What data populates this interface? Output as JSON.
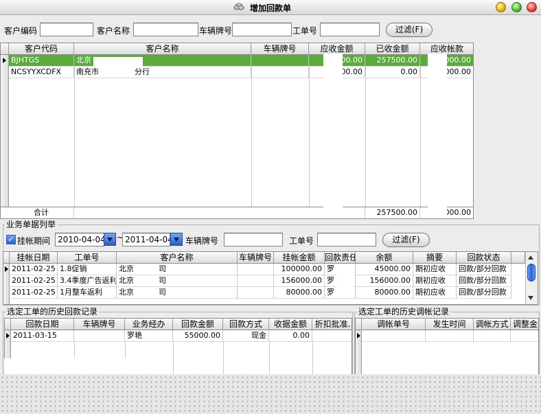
{
  "window": {
    "title": "增加回款单"
  },
  "filter": {
    "customer_code_label": "客户编码",
    "customer_name_label": "客户名称",
    "plate_label": "车辆牌号",
    "order_no_label": "工单号",
    "customer_code_value": "",
    "customer_name_value": "",
    "plate_value": "",
    "order_no_value": "",
    "filter_button": "过滤(F)"
  },
  "customers": {
    "columns": [
      "客户代码",
      "客户名称",
      "车辆牌号",
      "应收金额",
      "已收金额",
      "应收帐款"
    ],
    "rows": [
      {
        "code": "BJHTGS",
        "name": "北京",
        "plate": "",
        "receivable": "00.00",
        "received": "257500.00",
        "balance": "000.00"
      },
      {
        "code": "NCSYYXCDFX",
        "name": "南充市",
        "name_suffix": "分行",
        "plate": "",
        "receivable": "00.00",
        "received": "0.00",
        "balance": "000.00"
      }
    ],
    "footer": {
      "label": "合计",
      "receivable": "",
      "received": "257500.00",
      "balance": "000.00"
    }
  },
  "business": {
    "group_title": "业务单据列举",
    "period_label": "挂帐期间",
    "period_checked": true,
    "date_from": "2010-04-04",
    "tilde": "~",
    "date_to": "2011-04-04",
    "plate_label": "车辆牌号",
    "plate_value": "",
    "order_no_label": "工单号",
    "order_no_value": "",
    "filter_button": "过滤(F)",
    "columns": [
      "挂帐日期",
      "工单号",
      "客户名称",
      "车辆牌号",
      "挂帐金额",
      "回款责任人",
      "余额",
      "摘要",
      "回款状态"
    ],
    "rows": [
      {
        "date": "2011-02-25",
        "order": "1.8促销",
        "customer": "北京",
        "customer_suffix": "司",
        "plate": "",
        "amount": "100000.00",
        "person": "罗",
        "balance": "45000.00",
        "summary": "期初应收",
        "status": "回款/部分回款"
      },
      {
        "date": "2011-02-25",
        "order": "3.4季度广告返利",
        "customer": "北京",
        "customer_suffix": "司",
        "plate": "",
        "amount": "156000.00",
        "person": "罗",
        "balance": "156000.00",
        "summary": "期初应收",
        "status": "回款/部分回款"
      },
      {
        "date": "2011-02-25",
        "order": "1月整车返利",
        "customer": "北京",
        "customer_suffix": "司",
        "plate": "",
        "amount": "80000.00",
        "person": "罗",
        "balance": "80000.00",
        "summary": "期初应收",
        "status": "回款/部分回款"
      }
    ]
  },
  "history_payment": {
    "group_title": "选定工单的历史回款记录",
    "columns": [
      "回款日期",
      "车辆牌号",
      "业务经办",
      "回款金额",
      "回款方式",
      "收据金额",
      "折扣批准."
    ],
    "rows": [
      {
        "date": "2011-03-15",
        "plate": "",
        "handler": "罗艳",
        "amount": "55000.00",
        "method": "现金",
        "receipt": "0.00",
        "discount": ""
      }
    ]
  },
  "history_adjust": {
    "group_title": "选定工单的历史调帐记录",
    "columns": [
      "调帐单号",
      "发生时间",
      "调帐方式",
      "调整金"
    ]
  },
  "colors": {
    "selected_row": "#5aab3c",
    "window_bg": "#ececec",
    "accent_blue": "#2e5fc4"
  }
}
